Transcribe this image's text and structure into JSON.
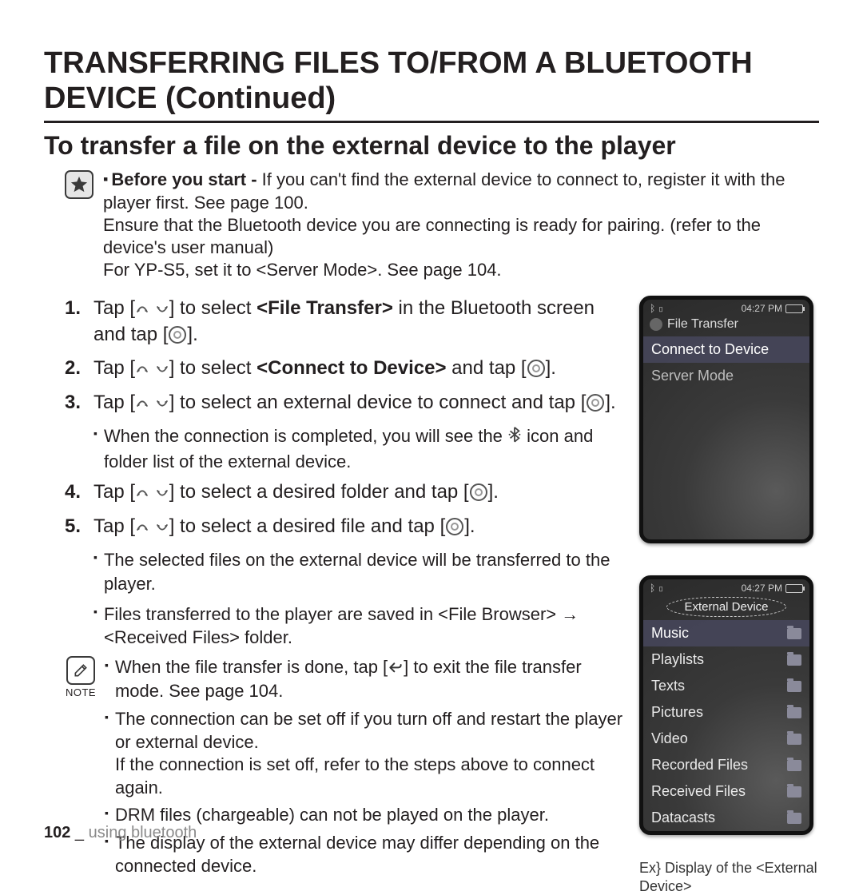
{
  "title": "TRANSFERRING FILES TO/FROM A BLUETOOTH DEVICE (Continued)",
  "subtitle": "To transfer a file on the external device to the player",
  "note": {
    "lead": "Before you start -",
    "l1": " If you can't find the external device to connect to, register it with the player first. See page 100.",
    "l2": "Ensure that the Bluetooth device you are connecting is ready for pairing. (refer to the device's user manual)",
    "l3": "For YP-S5, set it to <Server Mode>. See page 104."
  },
  "steps": {
    "s1a": "Tap [",
    "s1b": "] to select ",
    "s1bold": "<File Transfer>",
    "s1c": " in the Bluetooth screen and tap [",
    "s1d": "].",
    "s2a": "Tap [",
    "s2b": "] to select ",
    "s2bold": "<Connect to Device>",
    "s2c": " and tap [",
    "s2d": "].",
    "s3a": "Tap [",
    "s3b": "] to select an external device to connect and tap [",
    "s3c": "].",
    "s3sub": "When the connection is completed, you will see the ",
    "s3sub2": " icon and folder list of the external device.",
    "s4a": "Tap [",
    "s4b": "] to select a desired folder and tap [",
    "s4c": "].",
    "s5a": "Tap [",
    "s5b": "] to select a desired file and tap [",
    "s5c": "].",
    "s5sub1": "The selected files on the external device will be transferred to the player.",
    "s5sub2": "Files transferred to the player are saved in <File Browser> → <Received Files> folder."
  },
  "note2": {
    "label": "NOTE",
    "i1a": "When the file transfer is done, tap [",
    "i1b": "] to exit the file transfer mode. See page 104.",
    "i2": "The connection can be set off if you turn off and restart the player or external device.",
    "i2b": "If the connection is set off, refer to the steps above to connect again.",
    "i3": "DRM files (chargeable) can not be played on the player.",
    "i4": "The display of the external device may differ depending on the connected device."
  },
  "device1": {
    "time": "04:27 PM",
    "header": "File Transfer",
    "row1": "Connect to Device",
    "row2": "Server Mode"
  },
  "device2": {
    "time": "04:27 PM",
    "badge": "External Device",
    "rows": [
      "Music",
      "Playlists",
      "Texts",
      "Pictures",
      "Video",
      "Recorded Files",
      "Received Files",
      "Datacasts"
    ],
    "caption": "Ex} Display of the <External Device>"
  },
  "footer": {
    "page": "102",
    "sep": " _ ",
    "section": "using bluetooth"
  }
}
